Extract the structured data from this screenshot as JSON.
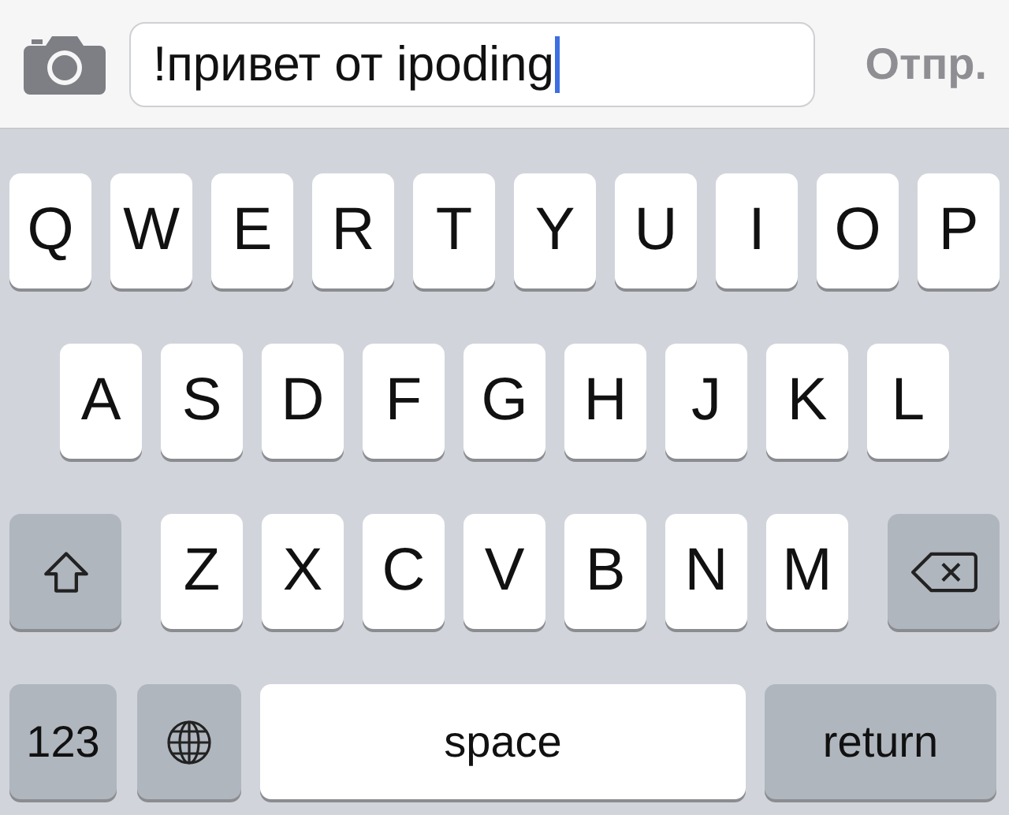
{
  "message_bar": {
    "input": {
      "value": "!привет от ipoding"
    },
    "send_button": {
      "label": "Отпр.",
      "disabled": true
    }
  },
  "keyboard": {
    "letter_rows": [
      {
        "keys": [
          {
            "kind": "letter",
            "label": "Q"
          },
          {
            "kind": "letter",
            "label": "W"
          },
          {
            "kind": "letter",
            "label": "E"
          },
          {
            "kind": "letter",
            "label": "R"
          },
          {
            "kind": "letter",
            "label": "T"
          },
          {
            "kind": "letter",
            "label": "Y"
          },
          {
            "kind": "letter",
            "label": "U"
          },
          {
            "kind": "letter",
            "label": "I"
          },
          {
            "kind": "letter",
            "label": "O"
          },
          {
            "kind": "letter",
            "label": "P"
          }
        ]
      },
      {
        "keys": [
          {
            "kind": "letter",
            "label": "A"
          },
          {
            "kind": "letter",
            "label": "S"
          },
          {
            "kind": "letter",
            "label": "D"
          },
          {
            "kind": "letter",
            "label": "F"
          },
          {
            "kind": "letter",
            "label": "G"
          },
          {
            "kind": "letter",
            "label": "H"
          },
          {
            "kind": "letter",
            "label": "J"
          },
          {
            "kind": "letter",
            "label": "K"
          },
          {
            "kind": "letter",
            "label": "L"
          }
        ]
      },
      {
        "keys": [
          {
            "kind": "shift"
          },
          {
            "kind": "letter",
            "label": "Z"
          },
          {
            "kind": "letter",
            "label": "X"
          },
          {
            "kind": "letter",
            "label": "C"
          },
          {
            "kind": "letter",
            "label": "V"
          },
          {
            "kind": "letter",
            "label": "B"
          },
          {
            "kind": "letter",
            "label": "N"
          },
          {
            "kind": "letter",
            "label": "M"
          },
          {
            "kind": "delete"
          }
        ]
      }
    ],
    "bottom_row": {
      "numbers_key": {
        "label": "123"
      },
      "space_key": {
        "label": "space"
      },
      "return_key": {
        "label": "return"
      }
    }
  }
}
